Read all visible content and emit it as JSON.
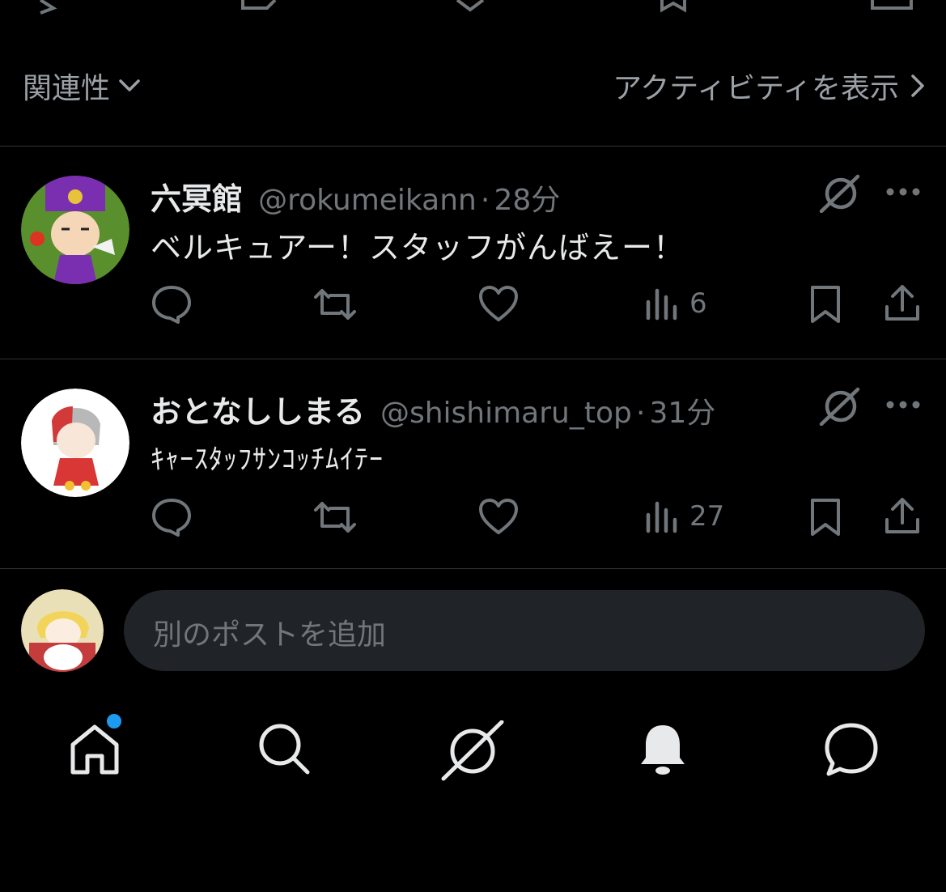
{
  "sort": {
    "label": "関連性",
    "activity_link": "アクティビティを表示"
  },
  "posts": [
    {
      "name": "六冥館",
      "handle": "@rokumeikann",
      "sep": "·",
      "time": "28分",
      "text": "ベルキュアー！スタッフがんばえー！",
      "views": "6"
    },
    {
      "name": "おとなししまる",
      "handle": "@shishimaru_top",
      "sep": "·",
      "time": "31分",
      "text": "ｷｬｰｽﾀｯﾌｻﾝｺｯﾁﾑｲﾃｰ",
      "views": "27"
    }
  ],
  "composer": {
    "placeholder": "別のポストを追加"
  },
  "nav": [
    "home-icon",
    "search-icon",
    "grok-icon",
    "notifications-icon",
    "messages-icon"
  ],
  "colors": {
    "background": "#000000",
    "accent": "#1d9bf0",
    "muted": "#71767b",
    "text": "#e7e9ea"
  }
}
